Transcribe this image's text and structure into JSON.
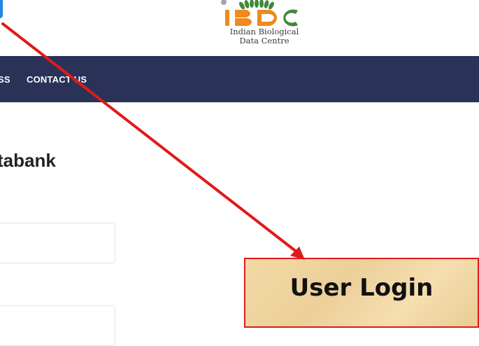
{
  "header": {
    "logo": {
      "text_mark": "IBDC",
      "line1": "Indian Biological",
      "line2": "Data Centre",
      "colors": {
        "orange": "#f08a1c",
        "green": "#3f8a3a"
      }
    }
  },
  "nav": {
    "background": "#2a3257",
    "items": [
      {
        "label": "SS"
      },
      {
        "label": "CONTACT US"
      }
    ]
  },
  "main": {
    "heading": "tabank",
    "fields": [
      {
        "value": "",
        "placeholder": ""
      },
      {
        "value": "",
        "placeholder": ""
      }
    ]
  },
  "annotation": {
    "callout_label": "User Login",
    "arrow_color": "#e01a1a",
    "callout_border_color": "#e01a1a"
  }
}
